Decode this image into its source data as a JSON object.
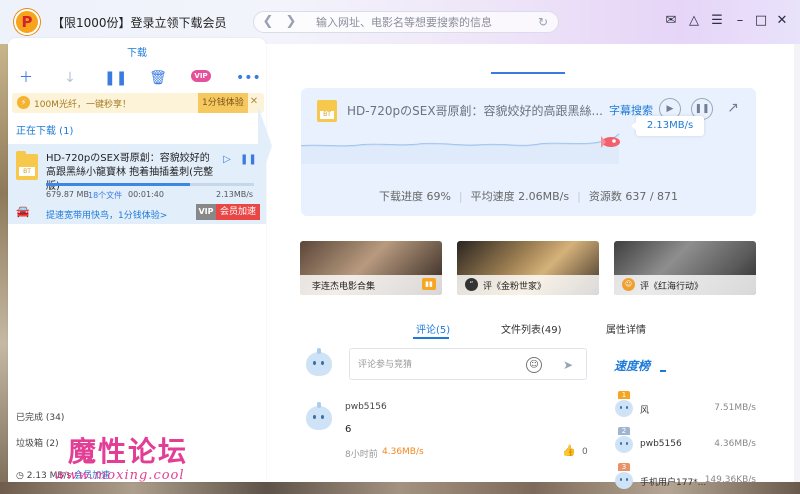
{
  "window": {
    "title": "【限1000份】登录立领下载会员",
    "logo_text": "P",
    "url_placeholder": "输入网址、电影名等想要搜索的信息"
  },
  "left_panel": {
    "header": "下载",
    "toolbar_icons": [
      "plus-icon",
      "download-arrow-icon",
      "pause-icon",
      "trash-icon",
      "vip-icon",
      "more-icon"
    ],
    "vip_badge": "VIP",
    "promo": {
      "text": "100M光纤，一键秒享！",
      "trial_button": "1分钱体验"
    },
    "downloading_section": "正在下载 (1)",
    "task": {
      "file_tag": "BT",
      "name": "HD-720pのSEX哥原創：容貌姣好的高跟黑絲小龍寶林 抱着抽插羞刺(完整版)",
      "progress": 0.69,
      "size": "679.87 MB",
      "file_count": "18个文件",
      "time_left": "00:01:40",
      "speed": "2.13MB/s",
      "speedup_text": "提速宽带用快鸟，1分钱体验>",
      "vip_tag": "VIP",
      "member_button": "会员加速"
    },
    "completed_section": "已完成 (34)",
    "trash_section": "垃圾箱 (2)",
    "footer_speed": "2.13 MB/s",
    "footer_member": "会员加速",
    "watermark_big": "魔性论坛",
    "watermark_small": "www.moxing.cool"
  },
  "detail": {
    "file_tag": "BT",
    "title": "HD-720pのSEX哥原創：容貌姣好的高跟黑絲...",
    "subtitle_search": "字幕搜索",
    "current_speed": "2.13MB/s",
    "progress_label": "下载进度 69%",
    "avg_speed_label": "平均速度 2.06MB/s",
    "resources_label": "资源数 637 / 871"
  },
  "related": [
    {
      "label": "李连杰电影合集"
    },
    {
      "label": "评《金粉世家》"
    },
    {
      "label": "评《红海行动》"
    }
  ],
  "content_tabs": {
    "comments": "评论(5)",
    "files": "文件列表(49)",
    "properties": "属性详情"
  },
  "comment_box": {
    "placeholder": "评论参与竞猜"
  },
  "comment": {
    "user": "pwb5156",
    "text": "6",
    "time": "8小时前",
    "speed": "4.36MB/s",
    "likes": "0"
  },
  "ranking": {
    "title": "速度榜",
    "entries": [
      {
        "name": "风",
        "speed": "7.51MB/s"
      },
      {
        "name": "pwb5156",
        "speed": "4.36MB/s"
      },
      {
        "name": "手机用户177*...",
        "speed": "149.36KB/s"
      }
    ]
  },
  "colors": {
    "accent": "#1d7ad8",
    "member_red": "#e84746",
    "vip_pink": "#e64f9a",
    "speed_orange": "#f08a1c"
  }
}
